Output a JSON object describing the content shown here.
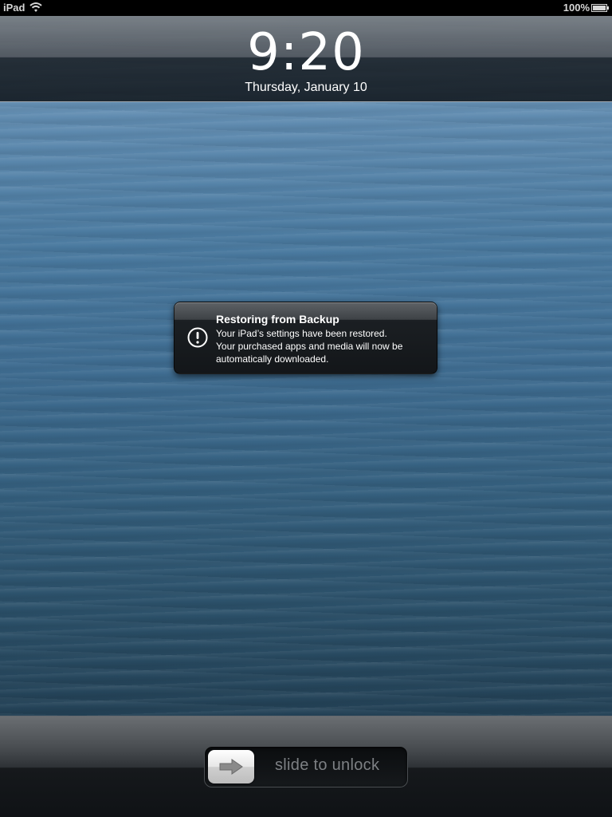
{
  "status_bar": {
    "carrier": "iPad",
    "wifi_icon": "wifi-icon",
    "battery_percent": "100%",
    "battery_icon": "battery-icon",
    "battery_level": 1.0
  },
  "lock_screen": {
    "time": "9:20",
    "date": "Thursday, January 10"
  },
  "notification": {
    "icon": "alert-icon",
    "title": "Restoring from Backup",
    "line1": "Your iPad’s settings have been restored.",
    "line2": "Your purchased apps and media will now be",
    "line3": "automatically downloaded."
  },
  "unlock_slider": {
    "knob_icon": "arrow-right-icon",
    "label": "slide to unlock"
  }
}
